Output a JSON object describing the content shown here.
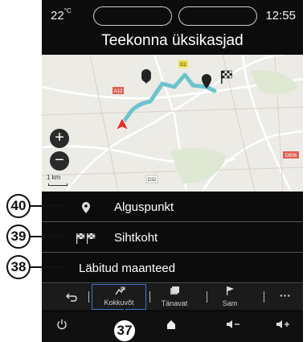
{
  "status": {
    "temperature": "22",
    "temperature_unit": "°C",
    "time": "12:55"
  },
  "title": "Teekonna üksikasjad",
  "map": {
    "road_labels": [
      "D2",
      "A12",
      "D32",
      "D32",
      "D906"
    ],
    "scale_label": "1 km"
  },
  "list": [
    {
      "label": "Alguspunkt",
      "icon": "location-pin-icon"
    },
    {
      "label": "Sihtkoht",
      "icon": "checkered-flags-icon"
    },
    {
      "label": "Läbitud maanteed",
      "icon": ""
    }
  ],
  "tabs": [
    {
      "label": "",
      "icon": "back-arrow-icon"
    },
    {
      "label": "Kokkuvõt",
      "icon": "route-summary-icon",
      "active": true
    },
    {
      "label": "Tänavat",
      "icon": "streets-icon"
    },
    {
      "label": "Sam",
      "icon": "flag-icon"
    },
    {
      "label": "",
      "icon": "more-icon"
    }
  ],
  "bottom_bar": [
    "power-icon",
    "home-icon",
    "volume-down-icon",
    "volume-up-icon"
  ],
  "callouts": [
    "40",
    "39",
    "38",
    "37"
  ]
}
